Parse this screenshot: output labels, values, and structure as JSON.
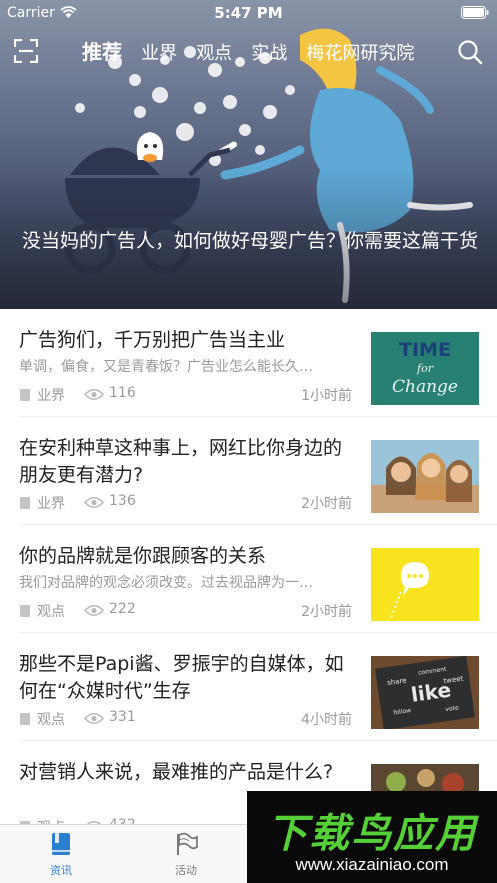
{
  "status_bar": {
    "carrier": "Carrier",
    "time": "5:47 PM"
  },
  "nav": {
    "tabs": [
      {
        "label": "推荐",
        "active": true
      },
      {
        "label": "业界",
        "active": false
      },
      {
        "label": "观点",
        "active": false
      },
      {
        "label": "实战",
        "active": false
      },
      {
        "label": "梅花网研究院",
        "active": false
      }
    ]
  },
  "hero": {
    "title": "没当妈的广告人，如何做好母婴广告？你需要这篇干货"
  },
  "feed": {
    "items": [
      {
        "title": "广告狗们，千万别把广告当主业",
        "subtitle": "单调，偏食，又是青春饭？广告业怎么能长久…",
        "category": "业界",
        "views": "116",
        "time": "1小时前",
        "thumb": "time-for-change"
      },
      {
        "title": "在安利种草这种事上，网红比你身边的朋友更有潜力?",
        "subtitle": "",
        "category": "业界",
        "views": "136",
        "time": "2小时前",
        "thumb": "friends-selfie"
      },
      {
        "title": "你的品牌就是你跟顾客的关系",
        "subtitle": "我们对品牌的观念必须改变。过去视品牌为一…",
        "category": "观点",
        "views": "222",
        "time": "2小时前",
        "thumb": "yellow-speech-bubble"
      },
      {
        "title": "那些不是Papi酱、罗振宇的自媒体，如何在“众媒时代”生存",
        "subtitle": "",
        "category": "观点",
        "views": "331",
        "time": "4小时前",
        "thumb": "social-chalkboard"
      },
      {
        "title": "对营销人来说，最难推的产品是什么?",
        "subtitle": "",
        "category": "观点",
        "views": "432",
        "time": "",
        "thumb": "food-table"
      }
    ]
  },
  "tabbar": {
    "items": [
      {
        "label": "资讯",
        "icon": "news-book-icon",
        "active": true
      },
      {
        "label": "活动",
        "icon": "flag-icon",
        "active": false
      }
    ]
  },
  "watermark": {
    "logo": "下载鸟应用",
    "url": "www.xiazainiao.com"
  },
  "colors": {
    "accent": "#2b7fd1",
    "watermark_green": "#55d036"
  }
}
